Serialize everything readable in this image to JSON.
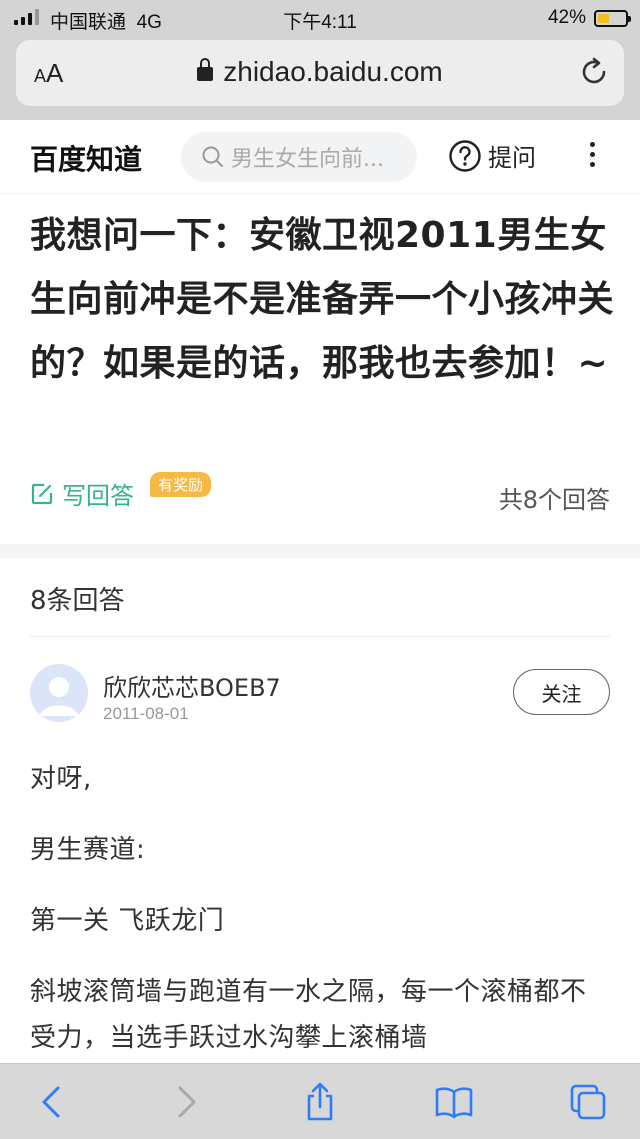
{
  "status_bar": {
    "carrier": "中国联通",
    "network": "4G",
    "time": "下午4:11",
    "battery_percent_text": "42%",
    "battery_level": 0.42
  },
  "browser": {
    "aa_label_small": "A",
    "aa_label_large": "A",
    "url": "zhidao.baidu.com"
  },
  "site_header": {
    "logo": "百度知道",
    "search_placeholder": "男生女生向前...",
    "ask_label": "提问"
  },
  "question": {
    "title": "我想问一下：安徽卫视2011男生女生向前冲是不是准备弄一个小孩冲关的？如果是的话，那我也去参加！~",
    "write_answer_label": "写回答",
    "reward_badge": "有奖励",
    "answer_count_text": "共8个回答"
  },
  "answers": {
    "header": "8条回答",
    "items": [
      {
        "username": "欣欣芯芯BOEB7",
        "date": "2011-08-01",
        "follow_label": "关注",
        "paragraphs": [
          "对呀,",
          "男生赛道:",
          "第一关 飞跃龙门",
          "斜坡滚筒墙与跑道有一水之隔，每一个滚桶都不受力，当选手跃过水沟攀上滚桶墙"
        ]
      }
    ]
  },
  "colors": {
    "accent_green": "#38b48b",
    "reward_orange": "#f5b944",
    "ios_blue": "#2f7cf6"
  }
}
